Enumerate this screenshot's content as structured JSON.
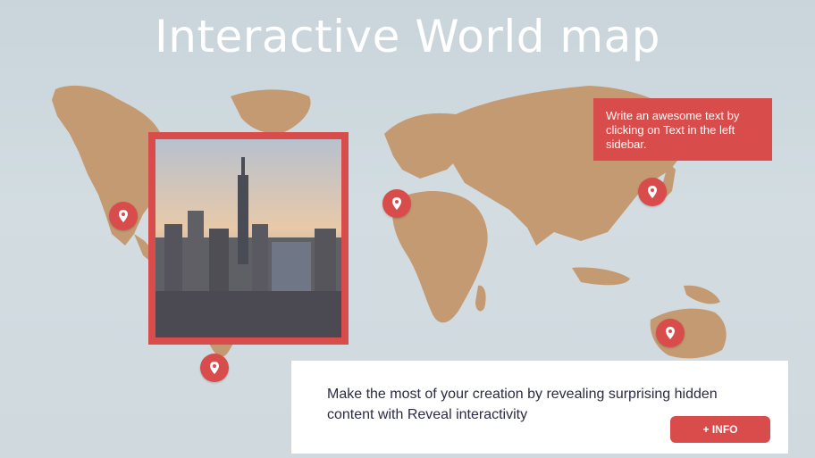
{
  "header": {
    "title": "Interactive World map"
  },
  "text_box": {
    "text": "Write an awesome text by clicking on Text in the left sidebar."
  },
  "info_card": {
    "text": "Make the most of your creation by revealing surprising hidden content with Reveal interactivity",
    "button_label": "+ INFO"
  },
  "photo": {
    "subject": "city skyline with skyscraper"
  },
  "pins": [
    {
      "name": "north-america-pin"
    },
    {
      "name": "south-america-pin"
    },
    {
      "name": "africa-pin"
    },
    {
      "name": "east-asia-pin"
    },
    {
      "name": "australia-pin"
    }
  ],
  "colors": {
    "background": "#cfd9de",
    "land": "#c49a72",
    "accent_red": "#d94c4c",
    "title": "#ffffff",
    "card_text": "#2b2b44"
  }
}
